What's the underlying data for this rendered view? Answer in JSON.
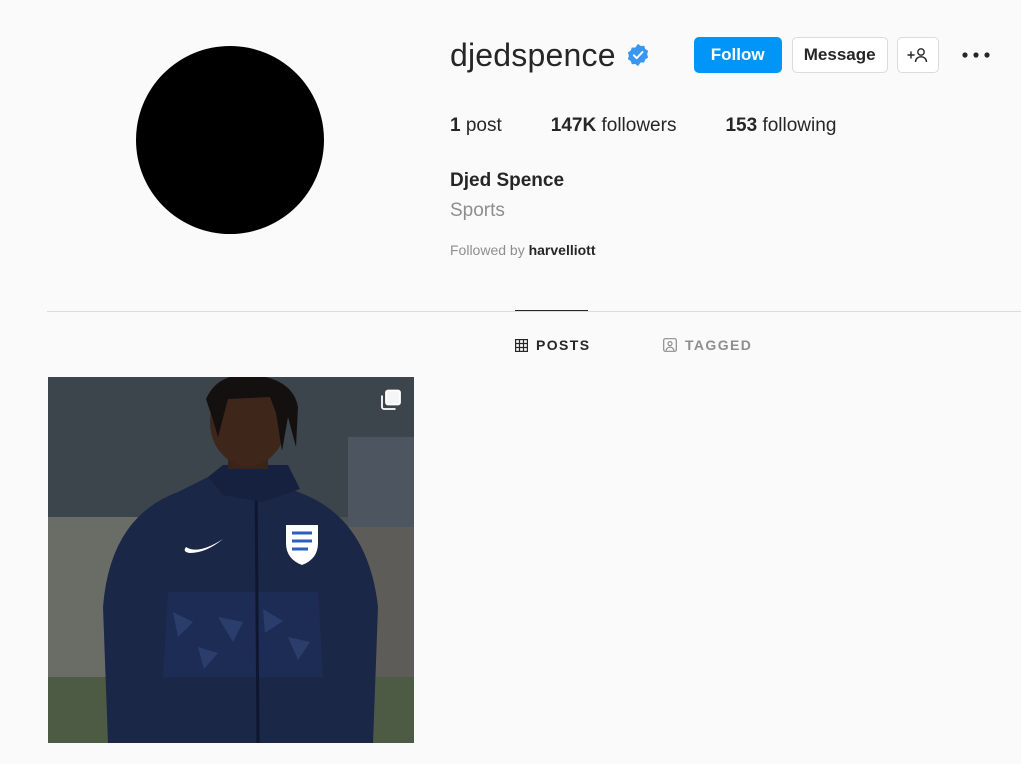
{
  "profile": {
    "username": "djedspence",
    "verified": true,
    "full_name": "Djed Spence",
    "category": "Sports",
    "followed_by_prefix": "Followed by ",
    "followed_by_user": "harvelliott"
  },
  "actions": {
    "follow_label": "Follow",
    "message_label": "Message"
  },
  "stats": {
    "posts_count": "1",
    "posts_label": "post",
    "followers_count": "147K",
    "followers_label": "followers",
    "following_count": "153",
    "following_label": "following"
  },
  "tabs": [
    {
      "label": "POSTS",
      "icon": "grid-icon",
      "active": true
    },
    {
      "label": "TAGGED",
      "icon": "tagged-icon",
      "active": false
    }
  ],
  "posts": [
    {
      "type": "carousel",
      "icon": "multiple-images-icon"
    }
  ],
  "colors": {
    "accent": "#0095f6",
    "verified": "#3897f0",
    "text": "#262626",
    "muted": "#8e8e8e",
    "border": "#dbdbdb",
    "background": "#fafafa"
  }
}
